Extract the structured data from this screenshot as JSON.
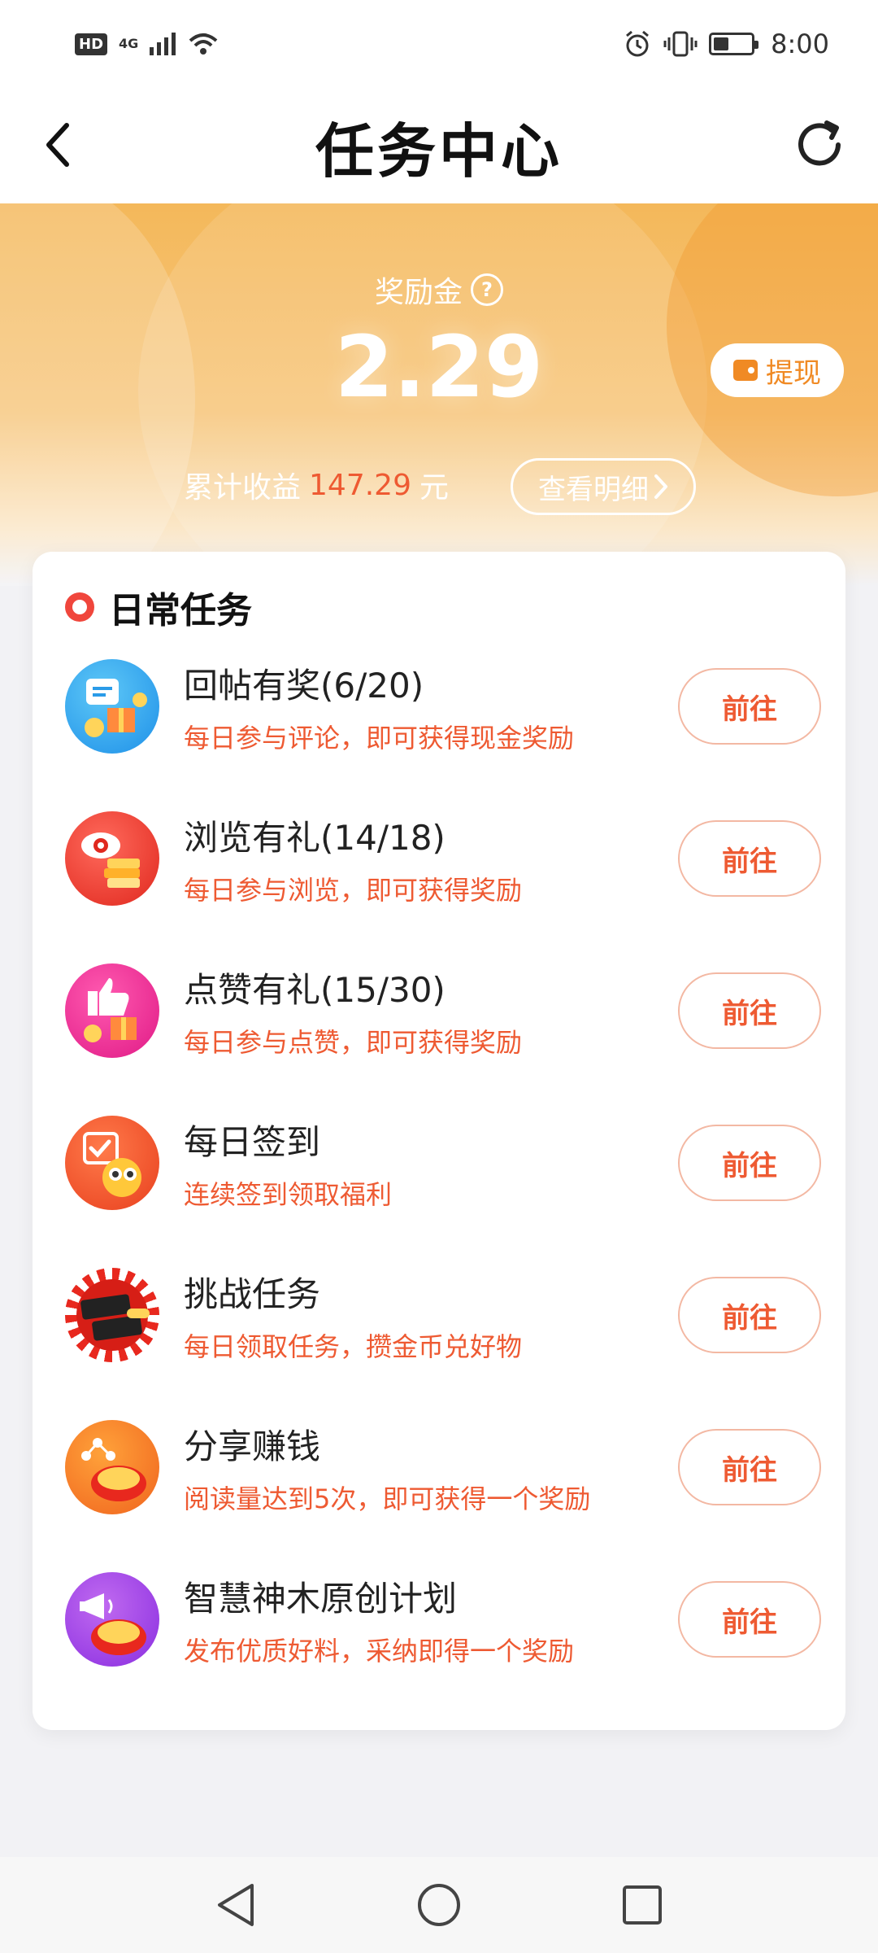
{
  "status_bar": {
    "hd": "HD",
    "network": "4G",
    "time": "8:00"
  },
  "header": {
    "title": "任务中心"
  },
  "hero": {
    "reward_label": "奖励金",
    "reward_amount": "2.29",
    "withdraw_label": "提现",
    "earnings_prefix": "累计收益",
    "earnings_value": "147.29",
    "earnings_unit": "元",
    "detail_label": "查看明细"
  },
  "tasks_card": {
    "title": "日常任务",
    "tasks": [
      {
        "title": "回帖有奖(6/20)",
        "desc": "每日参与评论，即可获得现金奖励",
        "button": "前往",
        "icon": "comment-gift-icon"
      },
      {
        "title": "浏览有礼(14/18)",
        "desc": "每日参与浏览，即可获得奖励",
        "button": "前往",
        "icon": "eye-books-icon"
      },
      {
        "title": "点赞有礼(15/30)",
        "desc": "每日参与点赞，即可获得奖励",
        "button": "前往",
        "icon": "thumbs-up-gift-icon"
      },
      {
        "title": "每日签到",
        "desc": "连续签到领取福利",
        "button": "前往",
        "icon": "calendar-checkin-icon"
      },
      {
        "title": "挑战任务",
        "desc": "每日领取任务，攒金币兑好物",
        "button": "前往",
        "icon": "challenge-badge-icon"
      },
      {
        "title": "分享赚钱",
        "desc": "阅读量达到5次，即可获得一个奖励",
        "button": "前往",
        "icon": "share-coin-icon"
      },
      {
        "title": "智慧神木原创计划",
        "desc": "发布优质好料，采纳即得一个奖励",
        "button": "前往",
        "icon": "megaphone-coin-icon"
      }
    ]
  },
  "colors": {
    "accent": "#ee5a32",
    "hero_orange": "#f4b85a",
    "withdraw": "#f08a24"
  }
}
